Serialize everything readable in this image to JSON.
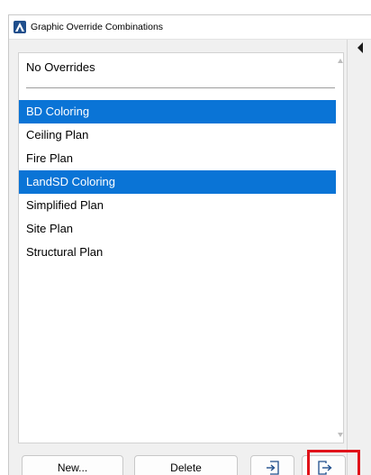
{
  "window": {
    "title": "Graphic Override Combinations",
    "app_icon": "archicad-icon",
    "collapse_icon": "collapse-arrow-icon"
  },
  "list": {
    "header_item": "No Overrides",
    "items": [
      {
        "label": "BD Coloring",
        "selected": true
      },
      {
        "label": "Ceiling Plan",
        "selected": false
      },
      {
        "label": "Fire Plan",
        "selected": false
      },
      {
        "label": "LandSD Coloring",
        "selected": true
      },
      {
        "label": "Simplified Plan",
        "selected": false
      },
      {
        "label": "Site Plan",
        "selected": false
      },
      {
        "label": "Structural Plan",
        "selected": false
      }
    ],
    "selection_color": "#0a74d6"
  },
  "buttons": {
    "new_label": "New...",
    "delete_label": "Delete",
    "import_icon": "import-icon",
    "export_icon": "export-icon"
  },
  "annotation": {
    "highlight_color": "#e0131a",
    "highlighted_target": "export-button"
  }
}
